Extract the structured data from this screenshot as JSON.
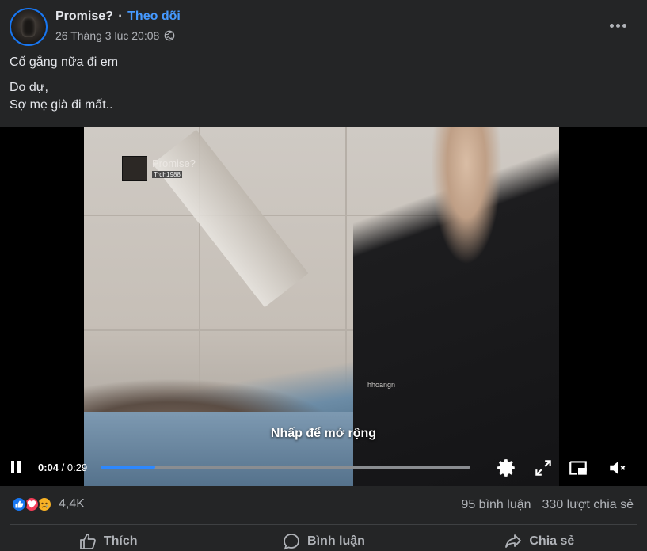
{
  "post": {
    "author": "Promise?",
    "separator": "·",
    "follow_label": "Theo dõi",
    "timestamp": "26 Tháng 3 lúc 20:08",
    "privacy_icon": "globe-icon",
    "more_icon": "more-options-icon",
    "caption": {
      "line1": "Cố gắng nữa đi em",
      "line2": "Do dự,",
      "line3": "Sợ mẹ già đi mất.."
    }
  },
  "video": {
    "watermark_title": "Promise?",
    "watermark_sub": "Trdh1988",
    "watermark_handle": "hhoangn",
    "expand_hint": "Nhấp để mở rộng",
    "current_time": "0:04",
    "time_separator": " / ",
    "total_time": "0:29",
    "progress_fraction": 0.147,
    "controls": [
      "pause-icon",
      "settings-icon",
      "fullscreen-icon",
      "picture-in-picture-icon",
      "muted-volume-icon"
    ]
  },
  "stats": {
    "reaction_count": "4,4K",
    "reactions": [
      "like-icon",
      "love-icon",
      "sad-icon"
    ],
    "comments": "95 bình luận",
    "shares": "330 lượt chia sẻ"
  },
  "actions": {
    "like": "Thích",
    "comment": "Bình luận",
    "share": "Chia sẻ"
  },
  "colors": {
    "background": "#242526",
    "accent": "#4599ff",
    "progress": "#2d88ff",
    "text_secondary": "#b0b3b8"
  }
}
